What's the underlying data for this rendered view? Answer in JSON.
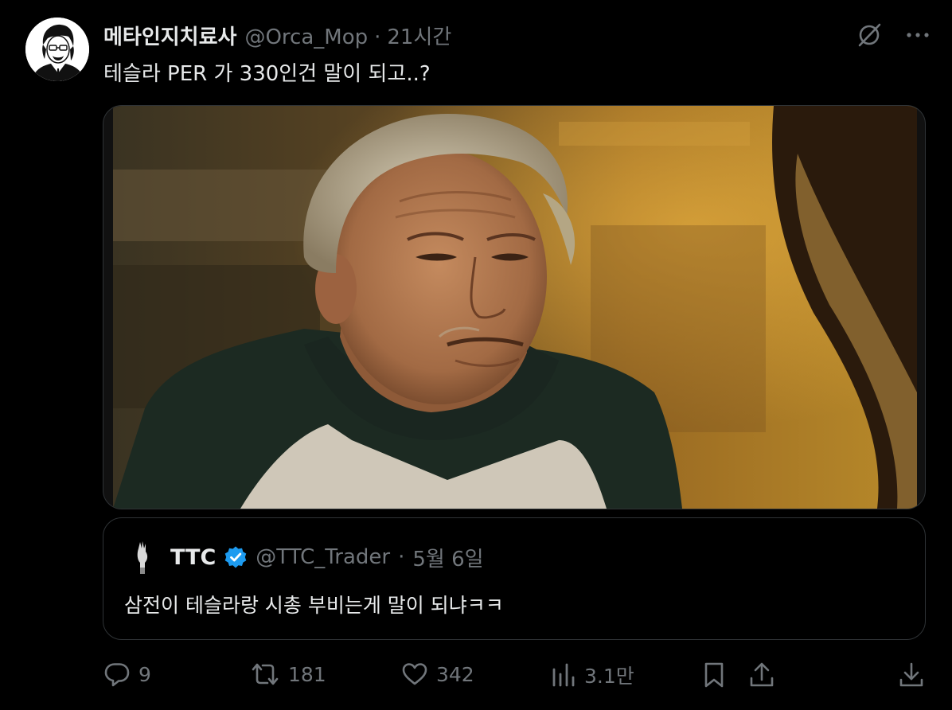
{
  "tweet": {
    "display_name": "메타인지치료사",
    "handle": "@Orca_Mop",
    "separator": "·",
    "time": "21시간",
    "text": "테슬라 PER 가 330인건 말이 되고..?"
  },
  "quote": {
    "display_name": "TTC",
    "verified": true,
    "handle": "@TTC_Trader",
    "separator": "·",
    "date": "5월 6일",
    "text": "삼전이 테슬라랑 시총 부비는게 말이 되냐ㅋㅋ"
  },
  "actions": {
    "replies": "9",
    "reposts": "181",
    "likes": "342",
    "views": "3.1만"
  },
  "icons": {
    "grok": "grok-icon",
    "more": "more-icon",
    "reply": "reply-icon",
    "repost": "repost-icon",
    "like": "like-icon",
    "views": "views-icon",
    "bookmark": "bookmark-icon",
    "share": "share-icon",
    "download": "download-icon"
  },
  "colors": {
    "background": "#000000",
    "primary_text": "#e7e9ea",
    "secondary_text": "#71767b",
    "border": "#2f3336",
    "verified_blue": "#1d9bf0"
  }
}
